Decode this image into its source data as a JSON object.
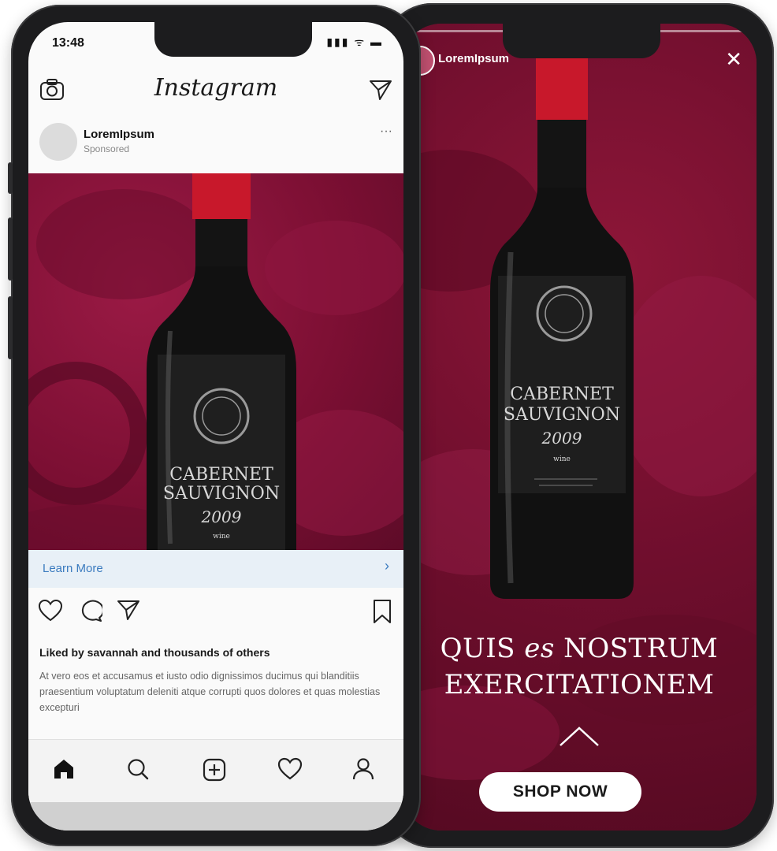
{
  "left_phone": {
    "status": {
      "time": "13:48",
      "icons": "▮▮▮ ᯤ ▬"
    },
    "header": {
      "app_name": "Instagram"
    },
    "post": {
      "username": "LoremIpsum",
      "sponsored": "Sponsored",
      "more": "···",
      "bottle_label": {
        "line1": "CABERNET",
        "line2": "SAUVIGNON",
        "year": "2009",
        "small": "wine"
      },
      "cta": {
        "label": "Learn More",
        "chevron": "›"
      },
      "liked_by": "Liked by savannah and thousands of others",
      "caption": "At vero eos et accusamus et iusto odio dignissimos ducimus qui blanditiis praesentium voluptatum deleniti atque corrupti quos dolores et quas molestias excepturi"
    },
    "icons": {
      "camera": "camera-icon",
      "direct": "send-icon",
      "like": "heart-icon",
      "comment": "comment-icon",
      "share": "send-icon",
      "save": "bookmark-icon",
      "home": "home-icon",
      "search": "search-icon",
      "add": "add-post-icon",
      "activity": "heart-icon",
      "profile": "profile-icon"
    }
  },
  "right_phone": {
    "story": {
      "username": "LoremIpsum",
      "close": "✕",
      "bottle_label": {
        "line1": "CABERNET",
        "line2": "SAUVIGNON",
        "year": "2009",
        "small": "wine"
      },
      "headline_part1": "QUIS",
      "headline_amp": "es",
      "headline_part2": "NOSTRUM",
      "headline_line2": "EXERCITATIONEM",
      "cta": "SHOP NOW"
    }
  },
  "colors": {
    "wine": "#7c0f33",
    "link_blue": "#3b7bbf",
    "cap_red": "#c8182b"
  }
}
